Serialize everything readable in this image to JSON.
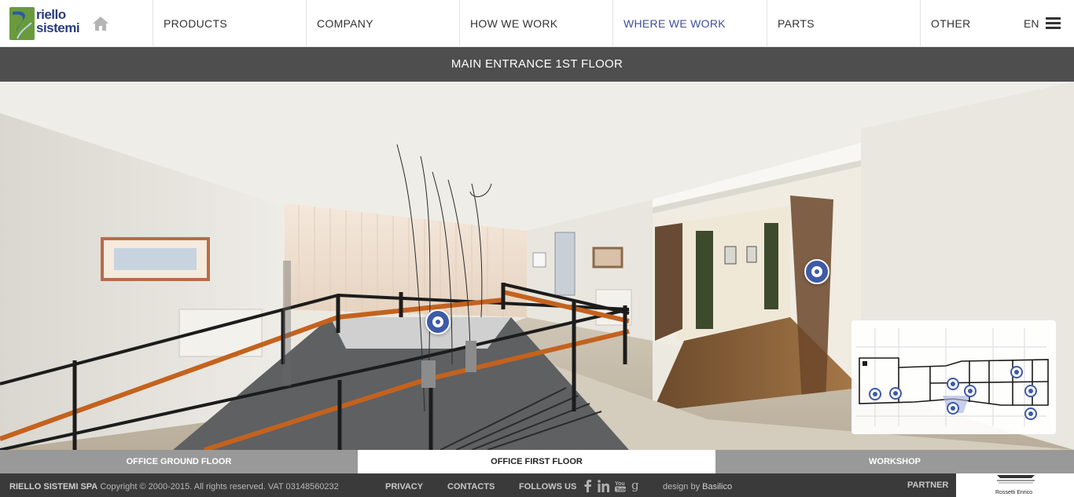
{
  "header": {
    "logo_line1": "riello",
    "logo_line2": "sistemi",
    "home_icon": "home-icon",
    "nav": [
      "PRODUCTS",
      "COMPANY",
      "HOW WE WORK",
      "WHERE WE WORK",
      "PARTS",
      "OTHER"
    ],
    "active_nav": "WHERE WE WORK",
    "language": "EN",
    "menu_icon": "hamburger-menu-icon"
  },
  "colors": {
    "accent": "#3e5aa8",
    "nav_active": "#3f4f9a",
    "title_bar": "#4e4e4e",
    "footer": "#3a3a3a"
  },
  "title_bar": {
    "title": "MAIN ENTRANCE 1ST FLOOR"
  },
  "panorama": {
    "hotspot_icon": "panorama-hotspot-icon",
    "hotspot_count": 2
  },
  "minimap": {
    "marker_count": 9,
    "marker_icon": "map-marker-icon"
  },
  "floor_tabs": [
    {
      "label": "OFFICE GROUND FLOOR",
      "active": false
    },
    {
      "label": "OFFICE FIRST FLOOR",
      "active": true
    },
    {
      "label": "WORKSHOP",
      "active": false
    }
  ],
  "footer": {
    "company": "RIELLO SISTEMI SPA",
    "copyright": "Copyright © 2000-2015. All rights reserved. VAT 03148560232",
    "privacy": "PRIVACY",
    "contacts": "CONTACTS",
    "follow": "FOLLOWS US",
    "social_icons": [
      "facebook-icon",
      "linkedin-icon",
      "youtube-icon",
      "google-plus-icon"
    ],
    "design_prefix": "design by",
    "designer": "Basilico",
    "partner_label": "PARTNER",
    "partner_name": "Rossetti Enrico"
  }
}
